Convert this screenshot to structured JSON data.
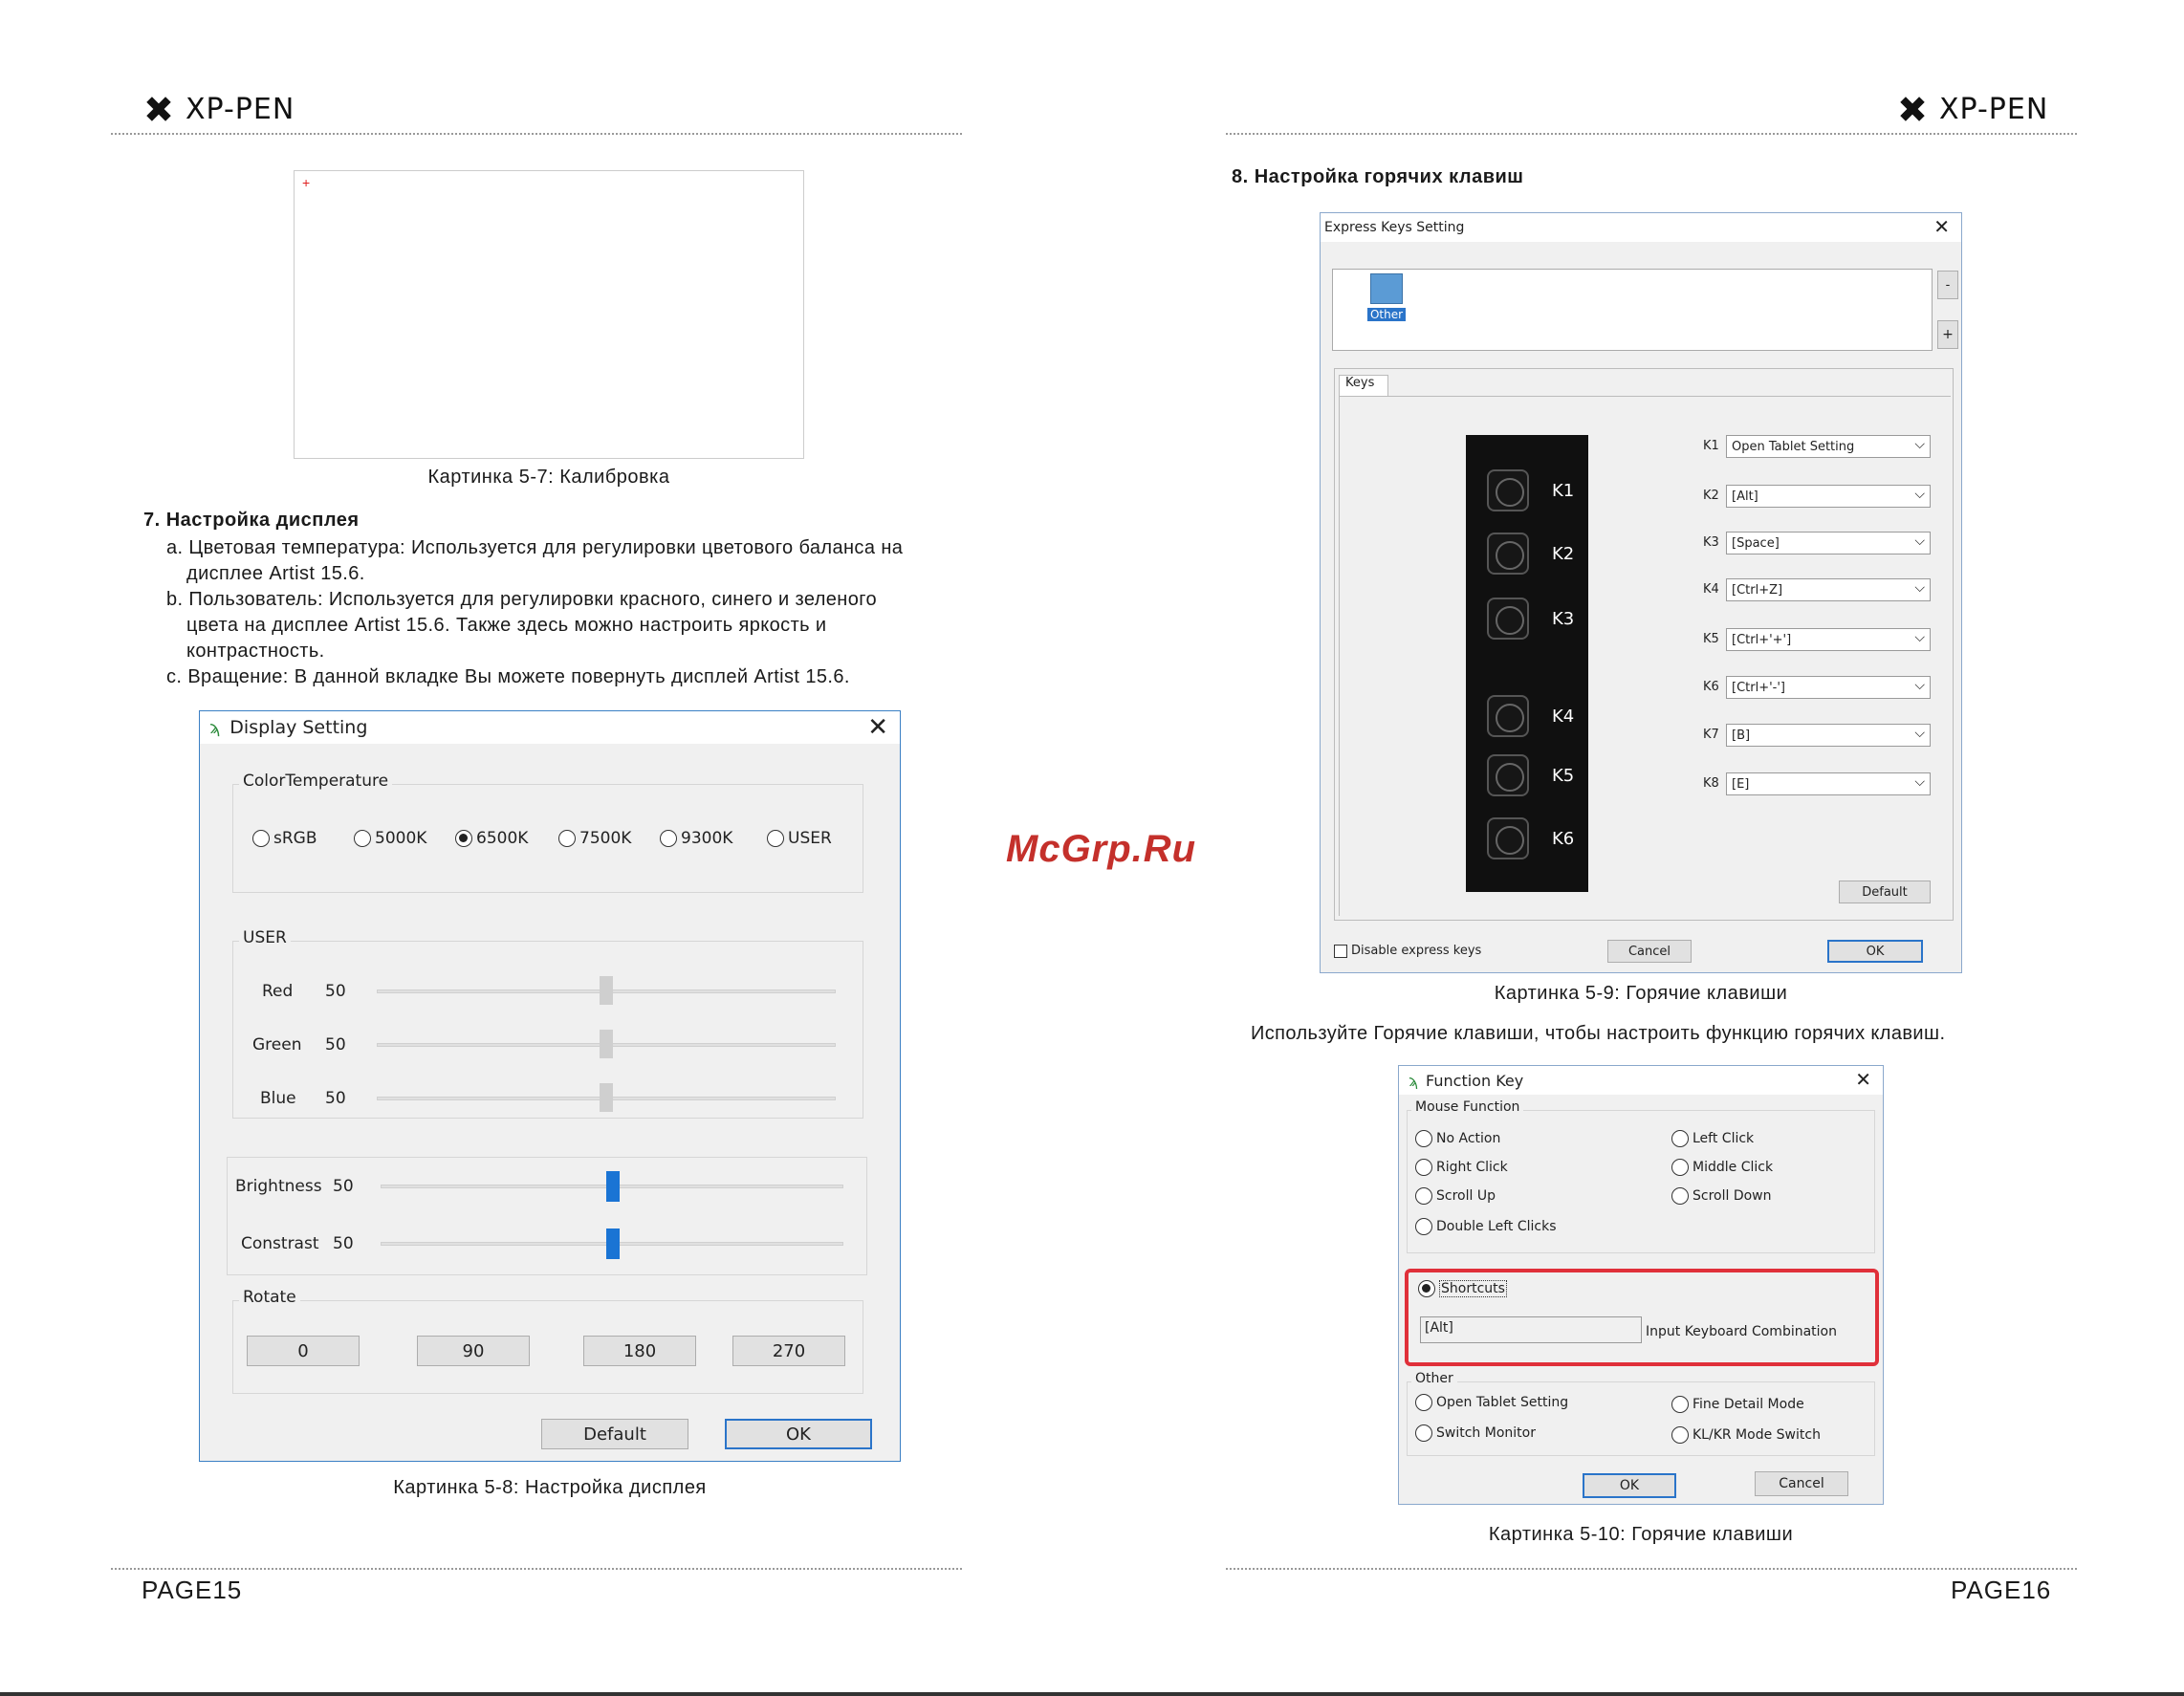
{
  "header": {
    "brand": "XP-PEN"
  },
  "left_page": {
    "figure_5_7": {
      "caption": "Картинка 5-7: Калибровка",
      "marker": "+"
    },
    "section7": {
      "title": "7. Настройка дисплея",
      "items": [
        "a. Цветовая температура: Используется для регулировки цветового баланса на",
        "дисплее Artist 15.6.",
        "b. Пользователь: Используется для регулировки красного, синего и зеленого",
        "цвета на дисплее Artist 15.6. Также здесь можно настроить яркость и",
        "контрастность.",
        "c. Вращение: В данной вкладке Вы можете повернуть дисплей Artist 15.6."
      ]
    },
    "display_dialog": {
      "title": "Display Setting",
      "color_temp_label": "ColorTemperature",
      "color_temps": [
        "sRGB",
        "5000K",
        "6500K",
        "7500K",
        "9300K",
        "USER"
      ],
      "selected_temp": "6500K",
      "user_label": "USER",
      "user_sliders": [
        {
          "label": "Red",
          "value": "50",
          "level": 0.5
        },
        {
          "label": "Green",
          "value": "50",
          "level": 0.5
        },
        {
          "label": "Blue",
          "value": "50",
          "level": 0.5
        }
      ],
      "bc_sliders": [
        {
          "label": "Brightness",
          "value": "50",
          "level": 0.5
        },
        {
          "label": "Constrast",
          "value": "50",
          "level": 0.5
        }
      ],
      "rotate_label": "Rotate",
      "rotate_buttons": [
        "0",
        "90",
        "180",
        "270"
      ],
      "default_btn": "Default",
      "ok_btn": "OK"
    },
    "figure_5_8": {
      "caption": "Картинка 5-8: Настройка дисплея"
    },
    "page_number": "PAGE15"
  },
  "watermark": "McGrp.Ru",
  "right_page": {
    "section8": {
      "title": "8. Настройка горячих клавиш"
    },
    "express_dialog": {
      "title": "Express Keys Setting",
      "app_label": "Other",
      "minus": "-",
      "plus": "+",
      "tab": "Keys",
      "tablet_keys": [
        "K1",
        "K2",
        "K3",
        "K4",
        "K5",
        "K6"
      ],
      "assignments": [
        {
          "key": "K1",
          "value": "Open Tablet Setting"
        },
        {
          "key": "K2",
          "value": "[Alt]"
        },
        {
          "key": "K3",
          "value": "[Space]"
        },
        {
          "key": "K4",
          "value": "[Ctrl+Z]"
        },
        {
          "key": "K5",
          "value": "[Ctrl+'+']"
        },
        {
          "key": "K6",
          "value": "[Ctrl+'-']"
        },
        {
          "key": "K7",
          "value": "[B]"
        },
        {
          "key": "K8",
          "value": "[E]"
        }
      ],
      "default_btn": "Default",
      "disable_label": "Disable express keys",
      "cancel_btn": "Cancel",
      "ok_btn": "OK"
    },
    "figure_5_9": {
      "caption": "Картинка 5-9: Горячие клавиши"
    },
    "usage_text": "Используйте Горячие клавиши, чтобы настроить функцию горячих клавиш.",
    "function_dialog": {
      "title": "Function Key",
      "mouse_label": "Mouse Function",
      "mouse_options": [
        "No Action",
        "Left Click",
        "Right Click",
        "Middle Click",
        "Scroll Up",
        "Scroll Down",
        "Double Left Clicks"
      ],
      "shortcuts_label": "Shortcuts",
      "shortcut_value": "[Alt]",
      "input_hint": "Input Keyboard Combination",
      "other_label": "Other",
      "other_options": [
        "Open Tablet Setting",
        "Fine Detail Mode",
        "Switch Monitor",
        "KL/KR Mode Switch"
      ],
      "ok_btn": "OK",
      "cancel_btn": "Cancel"
    },
    "figure_5_10": {
      "caption": "Картинка 5-10: Горячие клавиши"
    },
    "page_number": "PAGE16"
  }
}
